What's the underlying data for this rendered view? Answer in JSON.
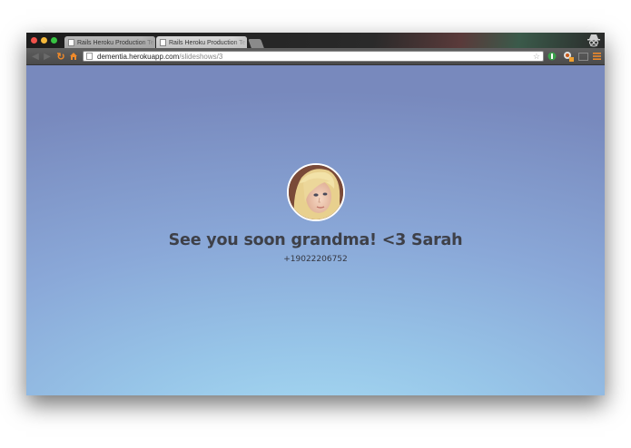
{
  "browser": {
    "tabs": [
      {
        "label": "Rails Heroku Production Te",
        "active": false
      },
      {
        "label": "Rails Heroku Production Te",
        "active": true
      }
    ],
    "address": {
      "host": "dementia.herokuapp.com",
      "path": "/slideshows/3"
    },
    "icons": [
      "close-light",
      "minimize-light",
      "zoom-light",
      "incognito-icon",
      "back-icon",
      "forward-icon",
      "reload-icon",
      "home-icon",
      "bookmark-star-icon",
      "evernote-icon",
      "extension-icon",
      "cast-icon",
      "menu-icon"
    ]
  },
  "slideshow": {
    "message": "See you soon grandma! <3 Sarah",
    "phone": "+19022206752",
    "avatar": "blonde-woman-photo"
  },
  "colors": {
    "background_top": "#7889bd",
    "background_bottom": "#a9dff5",
    "text": "#3e4048",
    "reload": "#f08a2a"
  }
}
